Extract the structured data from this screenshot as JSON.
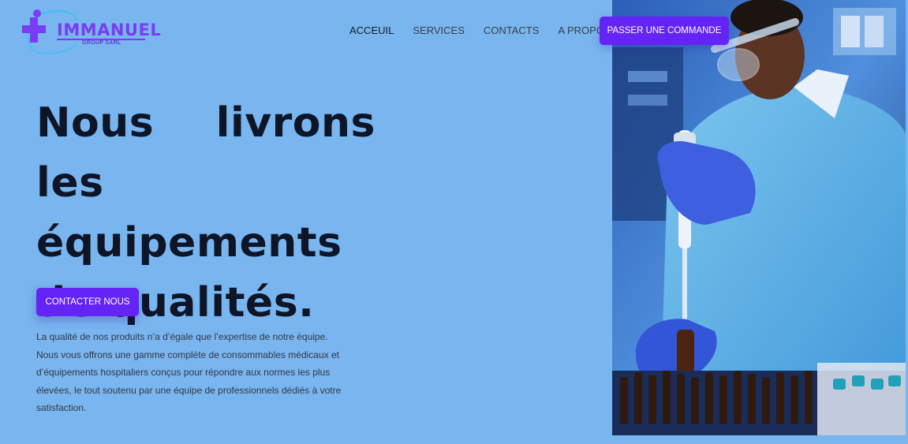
{
  "brand": {
    "name": "IMMANUEL",
    "tagline": "GROUP SARL"
  },
  "nav": {
    "items": [
      {
        "label": "ACCEUIL",
        "active": true
      },
      {
        "label": "SERVICES",
        "active": false
      },
      {
        "label": "CONTACTS",
        "active": false
      },
      {
        "label": "A PROPOS",
        "active": false
      }
    ]
  },
  "header": {
    "cta_label": "PASSER UNE COMMANDE"
  },
  "hero": {
    "title": "Nous livrons les équipements de qualités.",
    "cta_label": "CONTACTER NOUS",
    "description": "La qualité de nos produits n’a d’égale que l’expertise de notre équipe. Nous vous offrons une gamme complète de consommables médicaux et d’équipements hospitaliers conçus pour répondre aux normes les plus élevées, le tout soutenu par une équipe de professionnels dédiés à votre satisfaction."
  },
  "colors": {
    "background": "#79b5ef",
    "accent": "#6424f5",
    "heading": "#0d1527",
    "logo": "#7a3cf5"
  },
  "icons": {
    "logo": "medical-cross-icon"
  }
}
